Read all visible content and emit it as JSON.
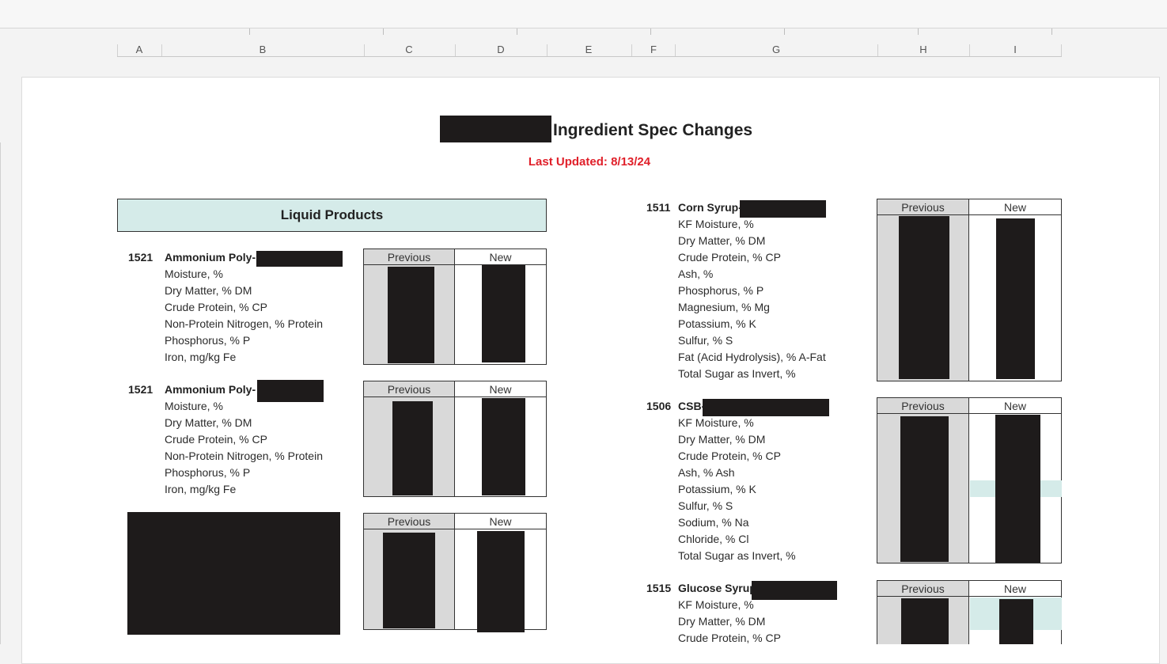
{
  "ruler": {
    "columns": [
      "A",
      "B",
      "C",
      "D",
      "E",
      "F",
      "G",
      "H",
      "I"
    ]
  },
  "document": {
    "title": "Ingredient Spec Changes",
    "last_updated": "Last Updated: 8/13/24",
    "section_title": "Liquid Products"
  },
  "table_headers": {
    "previous": "Previous",
    "new": "New"
  },
  "products": [
    {
      "code": "1521",
      "name": "Ammonium Poly-",
      "params": [
        "Moisture, %",
        "Dry Matter, % DM",
        "Crude Protein, % CP",
        "Non-Protein Nitrogen, % Protein",
        "Phosphorus, % P",
        "Iron, mg/kg Fe"
      ]
    },
    {
      "code": "1521",
      "name": "Ammonium Poly-",
      "params": [
        "Moisture, %",
        "Dry Matter, % DM",
        "Crude Protein, % CP",
        "Non-Protein Nitrogen, % Protein",
        "Phosphorus, % P",
        "Iron, mg/kg Fe"
      ]
    },
    {
      "code": "1511",
      "name": "Corn Syrup-",
      "params": [
        "KF Moisture, %",
        "Dry Matter, % DM",
        "Crude Protein, % CP",
        "Ash, %",
        "Phosphorus, % P",
        "Magnesium, % Mg",
        "Potassium, % K",
        "Sulfur, % S",
        "Fat (Acid Hydrolysis), % A-Fat",
        "Total Sugar as Invert, %"
      ]
    },
    {
      "code": "1506",
      "name": "CSB-",
      "params": [
        "KF Moisture, %",
        "Dry Matter, % DM",
        "Crude Protein, % CP",
        "Ash, % Ash",
        "Potassium, % K",
        "Sulfur, % S",
        "Sodium, % Na",
        "Chloride, % Cl",
        "Total Sugar as Invert, %"
      ]
    },
    {
      "code": "1515",
      "name": "Glucose Syrup",
      "params": [
        "KF Moisture, %",
        "Dry Matter, % DM",
        "Crude Protein, % CP"
      ]
    }
  ]
}
